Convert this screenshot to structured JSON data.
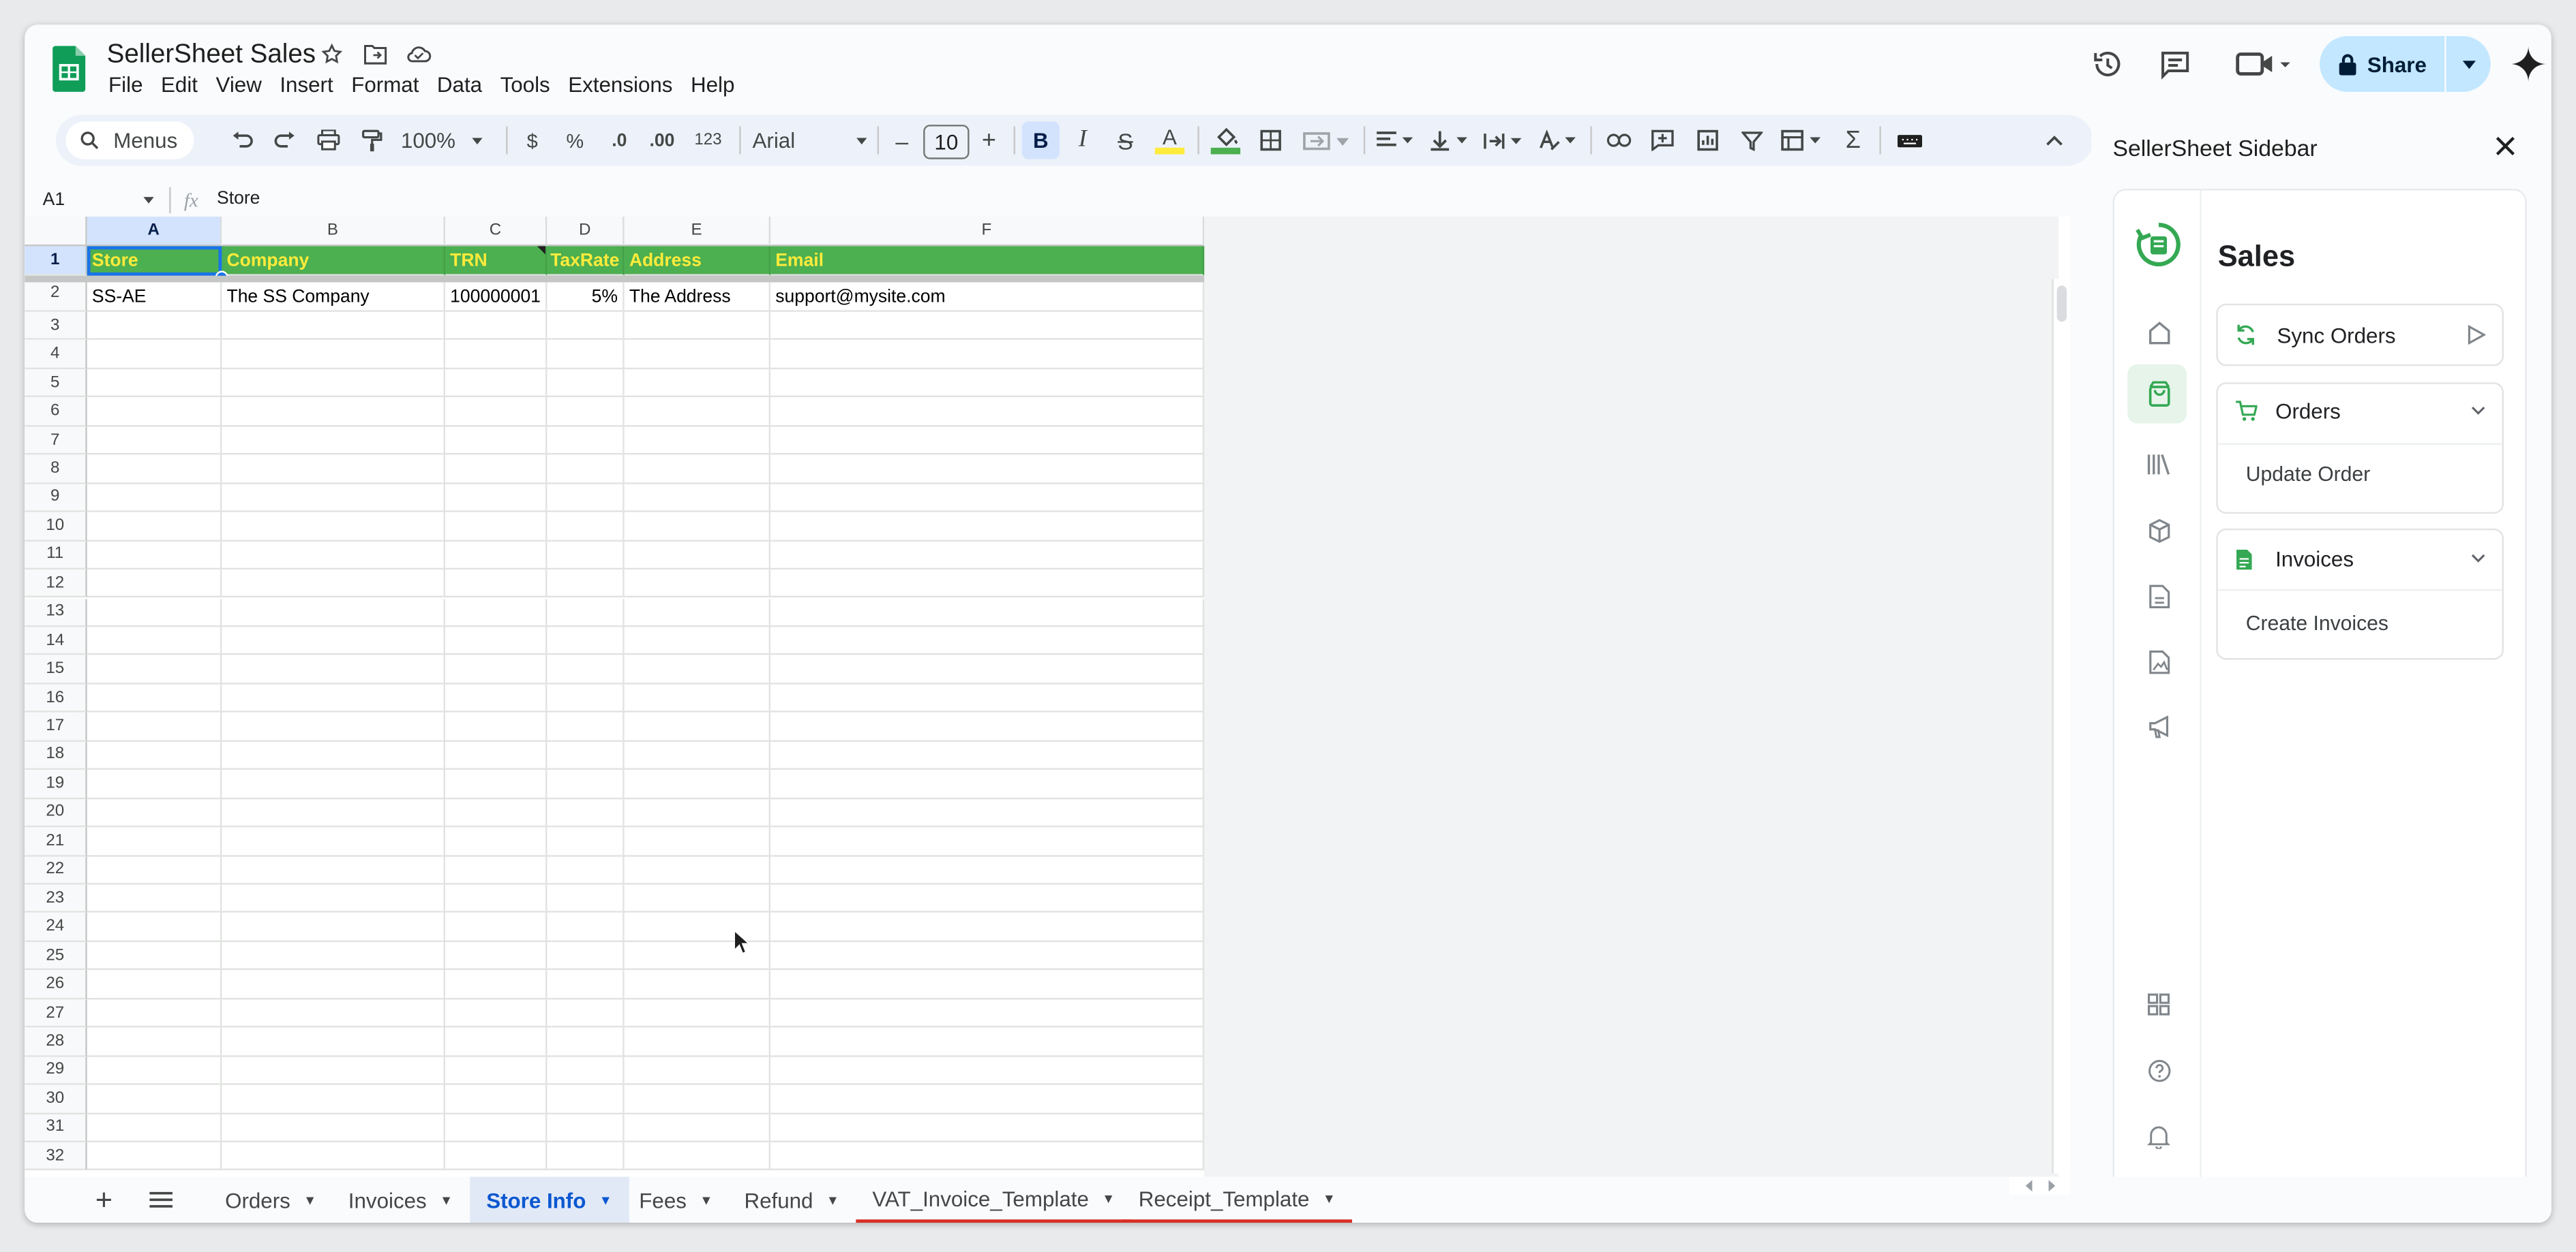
{
  "app": {
    "title": "SellerSheet Sales",
    "menu": [
      "File",
      "Edit",
      "View",
      "Insert",
      "Format",
      "Data",
      "Tools",
      "Extensions",
      "Help"
    ],
    "share_label": "Share"
  },
  "toolbar": {
    "search_label": "Menus",
    "zoom": "100%",
    "currency": "$",
    "percent": "%",
    "dec_decrease": ".0",
    "dec_increase": ".00",
    "number_format": "123",
    "font": "Arial",
    "font_size": "10",
    "minus": "–",
    "plus": "+"
  },
  "formula_bar": {
    "name_box": "A1",
    "fx": "fx",
    "content": "Store"
  },
  "sheet": {
    "columns": [
      "A",
      "B",
      "C",
      "D",
      "E",
      "F"
    ],
    "header_row": [
      "Store",
      "Company",
      "TRN",
      "TaxRate",
      "Address",
      "Email"
    ],
    "data_row": [
      "SS-AE",
      "The SS Company",
      "100000001",
      "5%",
      "The Address",
      "support@mysite.com"
    ],
    "row_numbers": [
      "1",
      "2",
      "3",
      "4",
      "5",
      "6",
      "7",
      "8",
      "9",
      "10",
      "11",
      "12",
      "13",
      "14",
      "15",
      "16",
      "17",
      "18",
      "19",
      "20",
      "21",
      "22",
      "23",
      "24",
      "25",
      "26",
      "27",
      "28",
      "29",
      "30",
      "31",
      "32"
    ],
    "header_color": "#4caf50",
    "header_text_color": "#ffeb3b"
  },
  "sidebar": {
    "title": "SellerSheet Sidebar",
    "section_title": "Sales",
    "sync_label": "Sync Orders",
    "orders_label": "Orders",
    "update_order_label": "Update Order",
    "invoices_label": "Invoices",
    "create_invoices_label": "Create Invoices",
    "accent_color": "#34a853"
  },
  "tabs": {
    "items": [
      "Orders",
      "Invoices",
      "Store Info",
      "Fees",
      "Refund",
      "VAT_Invoice_Template",
      "Receipt_Template"
    ],
    "active": "Store Info",
    "active_color": "#0b57d0"
  }
}
